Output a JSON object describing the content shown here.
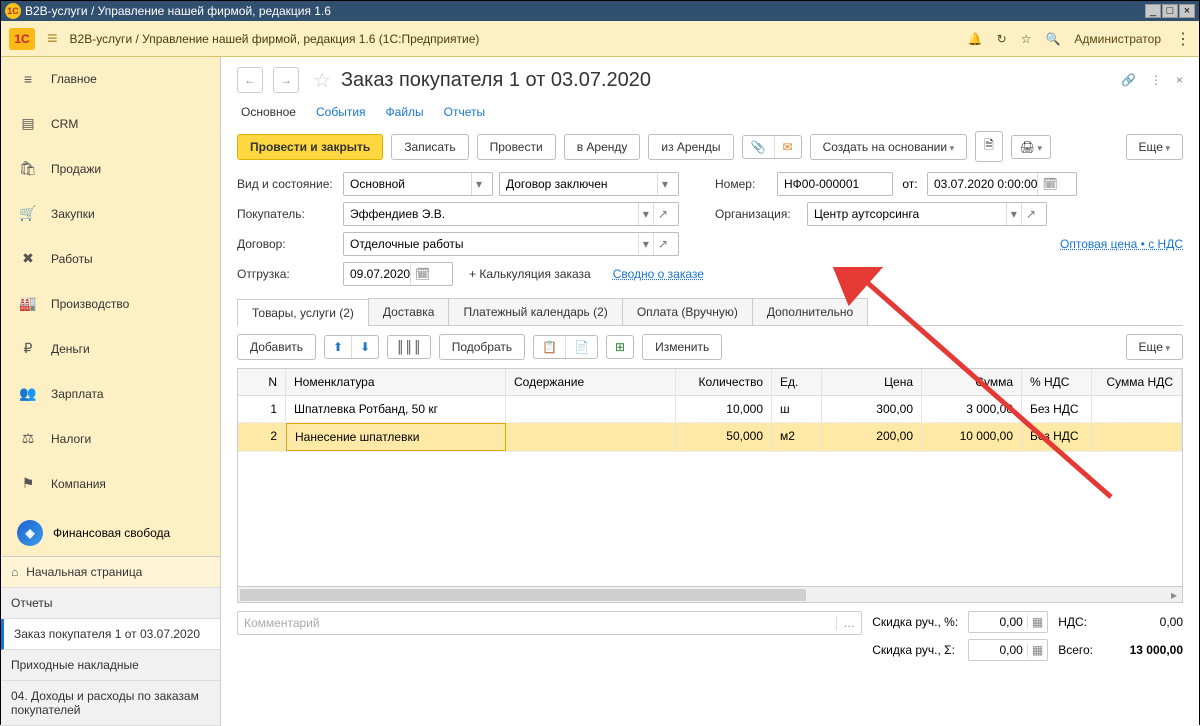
{
  "window": {
    "title": "В2В-услуги / Управление нашей фирмой, редакция 1.6"
  },
  "appbar": {
    "title": "В2В-услуги / Управление нашей фирмой, редакция 1.6  (1С:Предприятие)",
    "user": "Администратор"
  },
  "sidebar": {
    "items": [
      {
        "icon": "≡",
        "label": "Главное"
      },
      {
        "icon": "▤",
        "label": "CRM"
      },
      {
        "icon": "🛍",
        "label": "Продажи"
      },
      {
        "icon": "🛒",
        "label": "Закупки"
      },
      {
        "icon": "✖",
        "label": "Работы"
      },
      {
        "icon": "🏭",
        "label": "Производство"
      },
      {
        "icon": "₽",
        "label": "Деньги"
      },
      {
        "icon": "👥",
        "label": "Зарплата"
      },
      {
        "icon": "⚖",
        "label": "Налоги"
      },
      {
        "icon": "⚑",
        "label": "Компания"
      }
    ],
    "fin_label": "Финансовая свобода",
    "bottom": [
      "Начальная страница",
      "Отчеты",
      "Заказ покупателя 1 от 03.07.2020",
      "Приходные накладные",
      "04. Доходы и расходы по заказам покупателей"
    ]
  },
  "doc": {
    "title": "Заказ покупателя 1 от 03.07.2020",
    "page_tabs": [
      "Основное",
      "События",
      "Файлы",
      "Отчеты"
    ],
    "cmd": {
      "post_close": "Провести и закрыть",
      "save": "Записать",
      "post": "Провести",
      "to_rent": "в Аренду",
      "from_rent": "из Аренды",
      "create_based": "Создать на основании",
      "more": "Еще"
    },
    "fields": {
      "type_label": "Вид и состояние:",
      "type_val": "Основной",
      "state_val": "Договор заключен",
      "number_label": "Номер:",
      "number_val": "НФ00-000001",
      "from_label": "от:",
      "date_val": "03.07.2020  0:00:00",
      "buyer_label": "Покупатель:",
      "buyer_val": "Эффендиев Э.В.",
      "org_label": "Организация:",
      "org_val": "Центр аутсорсинга",
      "contract_label": "Договор:",
      "contract_val": "Отделочные работы",
      "price_link": "Оптовая цена • с НДС",
      "ship_label": "Отгрузка:",
      "ship_val": "09.07.2020",
      "calc_link": "+ Калькуляция заказа",
      "summary_link": "Сводно о заказе"
    },
    "subtabs": [
      "Товары, услуги (2)",
      "Доставка",
      "Платежный календарь (2)",
      "Оплата (Вручную)",
      "Дополнительно"
    ],
    "toolbar": {
      "add": "Добавить",
      "pick": "Подобрать",
      "edit": "Изменить",
      "more": "Еще"
    },
    "table": {
      "headers": {
        "n": "N",
        "nom": "Номенклатура",
        "cont": "Содержание",
        "qty": "Количество",
        "unit": "Ед.",
        "price": "Цена",
        "sum": "Сумма",
        "vatp": "% НДС",
        "vats": "Сумма НДС"
      },
      "rows": [
        {
          "n": "1",
          "nom": "Шпатлевка Ротбанд, 50 кг",
          "cont": "",
          "qty": "10,000",
          "unit": "ш",
          "price": "300,00",
          "sum": "3 000,00",
          "vatp": "Без НДС",
          "vats": ""
        },
        {
          "n": "2",
          "nom": "Нанесение шпатлевки",
          "cont": "",
          "qty": "50,000",
          "unit": "м2",
          "price": "200,00",
          "sum": "10 000,00",
          "vatp": "Без НДС",
          "vats": ""
        }
      ]
    },
    "footer": {
      "comment_ph": "Комментарий",
      "disc_pct_label": "Скидка руч., %:",
      "disc_pct": "0,00",
      "disc_sum_label": "Скидка руч., Σ:",
      "disc_sum": "0,00",
      "vat_label": "НДС:",
      "vat": "0,00",
      "total_label": "Всего:",
      "total": "13 000,00"
    }
  }
}
